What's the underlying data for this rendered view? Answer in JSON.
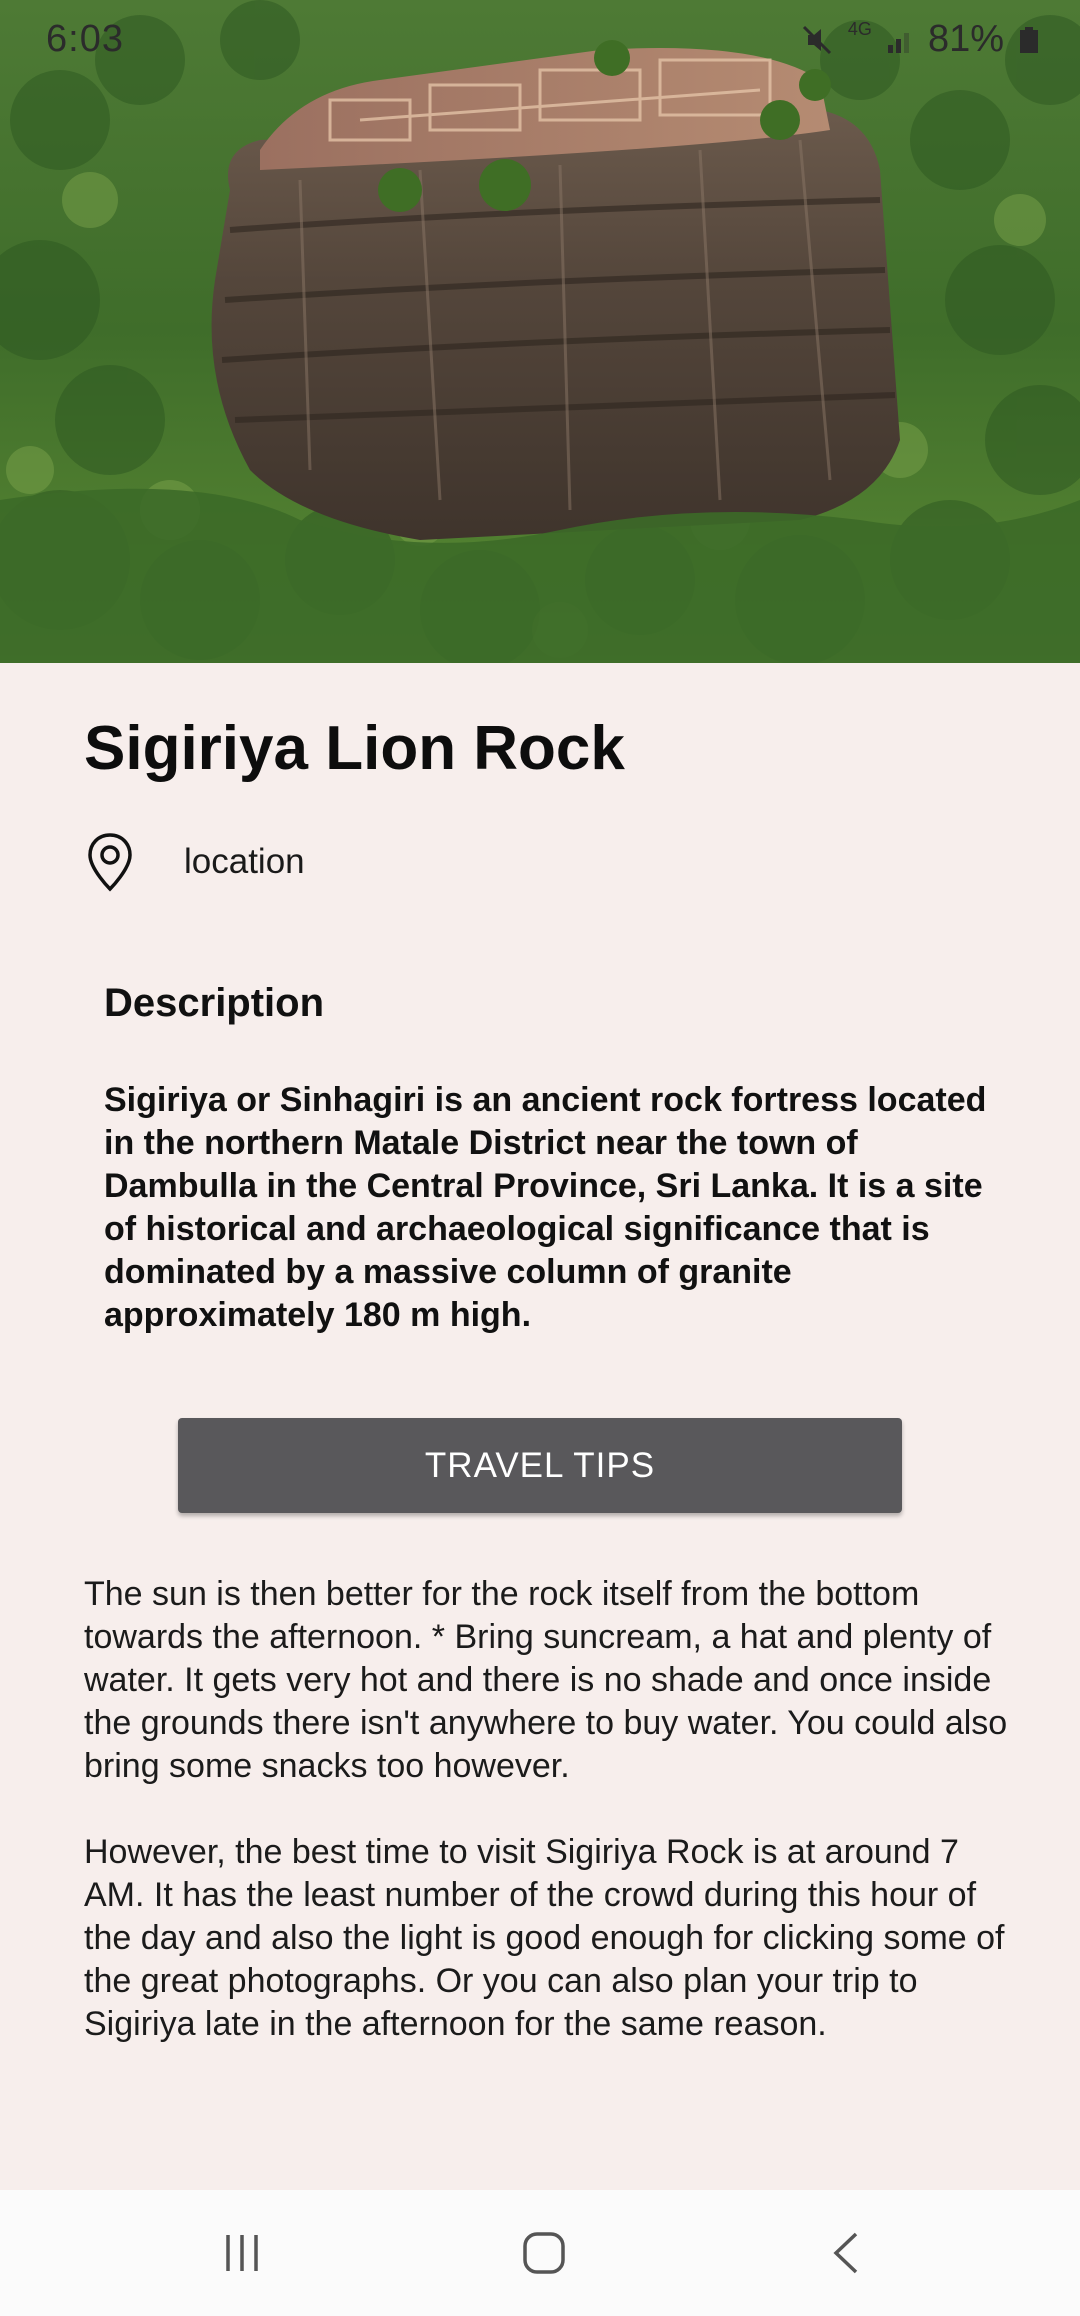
{
  "status_bar": {
    "time": "6:03",
    "network": "4G",
    "battery": "81%"
  },
  "place": {
    "title": "Sigiriya Lion Rock",
    "location_label": "location"
  },
  "description": {
    "heading": "Description",
    "body": "Sigiriya or Sinhagiri is an ancient rock fortress located in the northern Matale District near the town of Dambulla in the Central Province, Sri Lanka. It is a site of historical and archaeological significance that is dominated by a massive column of granite approximately 180 m high."
  },
  "travel_tips": {
    "button_label": "TRAVEL TIPS",
    "paragraph_1": "The sun is then better for the rock itself from the bottom towards the afternoon. * Bring suncream, a hat and plenty of water. It gets very hot and there is no shade and once inside the grounds there isn't anywhere to buy water. You could also bring some snacks too however.",
    "paragraph_2": "However, the best time to visit Sigiriya Rock is at around 7 AM. It has the least number of the crowd during this hour of the day and also the light is good enough for clicking some of the great photographs. Or you can also plan your trip to Sigiriya late in the afternoon for the same reason."
  },
  "icons": {
    "hero": "sigiriya-rock-photo",
    "location": "map-pin-icon",
    "nav_recents": "recent-apps-icon",
    "nav_home": "home-icon",
    "nav_back": "back-icon"
  },
  "colors": {
    "background": "#f7eeec",
    "button": "#59585b",
    "button_text": "#ffffff"
  }
}
